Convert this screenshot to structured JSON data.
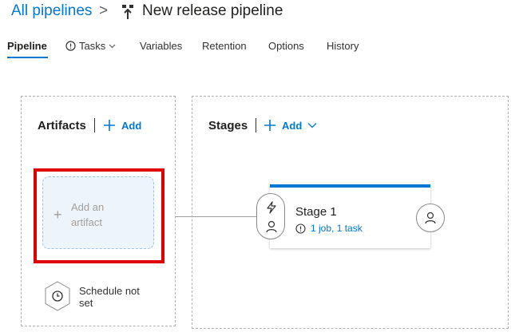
{
  "header": {
    "breadcrumb_link": "All pipelines",
    "breadcrumb_separator": ">",
    "title_icon": "release-pipeline-icon",
    "title": "New release pipeline"
  },
  "tabs": [
    {
      "label": "Pipeline",
      "active": true
    },
    {
      "label": "Tasks",
      "icon": "alert-circle-icon",
      "has_dropdown": true
    },
    {
      "label": "Variables"
    },
    {
      "label": "Retention"
    },
    {
      "label": "Options"
    },
    {
      "label": "History"
    }
  ],
  "artifacts": {
    "title": "Artifacts",
    "add_label": "Add",
    "add_card_label": "Add an artifact",
    "schedule_label": "Schedule not set"
  },
  "stages": {
    "title": "Stages",
    "add_label": "Add",
    "items": [
      {
        "name": "Stage 1",
        "summary": "1 job, 1 task"
      }
    ]
  },
  "colors": {
    "accent": "#0078d4",
    "highlight": "#e00000",
    "artifact_card_bg": "#edf5fb"
  }
}
